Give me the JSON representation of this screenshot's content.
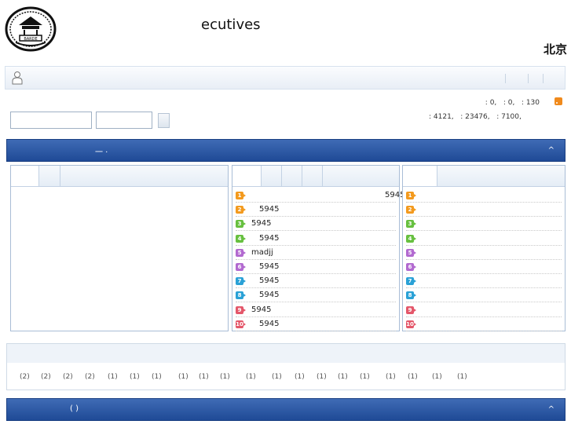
{
  "header": {
    "title": "ecutives",
    "title_right": "北京"
  },
  "stats": {
    "line1": ": 0,   : 0,   : 130",
    "line2": ": 4121,   : 23476,   : 7100,"
  },
  "section1": {
    "title": "一 ·",
    "arrow": "^"
  },
  "middle_list": [
    {
      "num": "1",
      "text": "5945"
    },
    {
      "num": "2",
      "text": "5945"
    },
    {
      "num": "3",
      "text": "5945"
    },
    {
      "num": "4",
      "text": "5945"
    },
    {
      "num": "5",
      "text": "madjj"
    },
    {
      "num": "6",
      "text": "5945"
    },
    {
      "num": "7",
      "text": "5945"
    },
    {
      "num": "8",
      "text": "5945"
    },
    {
      "num": "9",
      "text": "5945"
    },
    {
      "num": "10",
      "text": "5945"
    }
  ],
  "right_list": [
    "1",
    "2",
    "3",
    "4",
    "5",
    "6",
    "7",
    "8",
    "9",
    "10"
  ],
  "tags": [
    "(2)",
    "(2)",
    "(2)",
    "(2)",
    "(1)",
    "(1)",
    "(1)",
    "(1)",
    "(1)",
    "(1)",
    "(1)",
    "(1)",
    "(1)",
    "(1)",
    "(1)",
    "(1)",
    "(1)",
    "(1)",
    "(1)",
    "(1)"
  ],
  "section2": {
    "title": "(     )",
    "arrow": "^"
  },
  "colors": {
    "section_header": "#2a56a3",
    "rss": "#f08a1c"
  }
}
